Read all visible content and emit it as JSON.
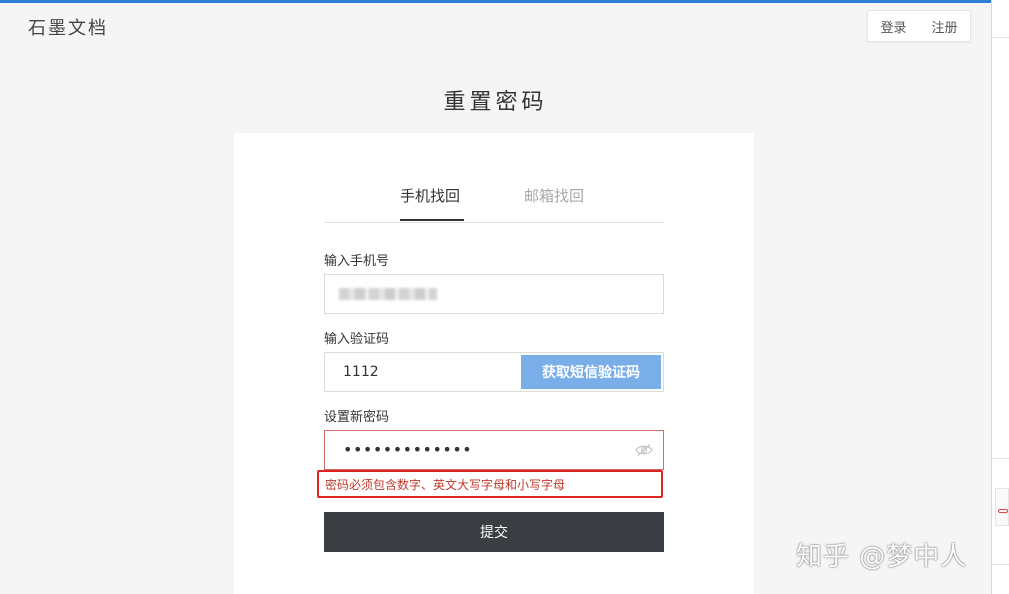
{
  "brand": "石墨文档",
  "header": {
    "login": "登录",
    "register": "注册"
  },
  "page_title": "重置密码",
  "tabs": [
    {
      "label": "手机找回",
      "active": true
    },
    {
      "label": "邮箱找回",
      "active": false
    }
  ],
  "form": {
    "phone_label": "输入手机号",
    "code_label": "输入验证码",
    "code_value": "1112",
    "sms_button": "获取短信验证码",
    "password_label": "设置新密码",
    "password_masked": "•••••••••••••",
    "error_text": "密码必须包含数字、英文大写字母和小写字母",
    "submit": "提交"
  },
  "watermark": "知乎 @梦中人",
  "colors": {
    "accent": "#2f7fd6",
    "sms_button": "#7aaee8",
    "submit": "#3a3d42",
    "error": "#d22222"
  },
  "icons": {
    "password_toggle": "eye-off-icon"
  }
}
